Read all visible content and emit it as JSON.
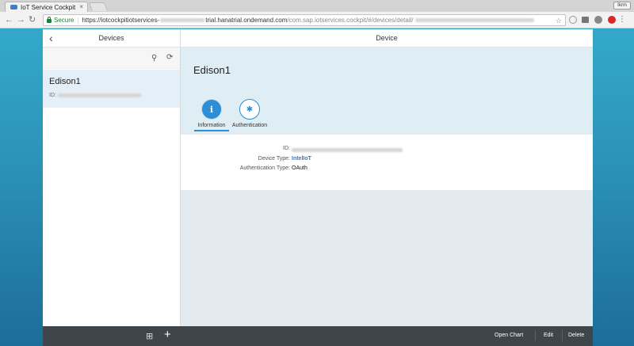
{
  "browser": {
    "tab_title": "IoT Service Cockpit",
    "tab_close": "×",
    "profile": "Ikrm",
    "secure_label": "Secure",
    "url_prefix": "https://iotcockpitiotservices-",
    "url_domain": "trial.hanatrial.ondemand.com",
    "url_path": "/com.sap.iotservices.cockpit/#/devices/detail/"
  },
  "master": {
    "title": "Devices",
    "back_icon": "chevron-left-icon",
    "search_icon": "search-icon",
    "refresh_icon": "refresh-icon",
    "items": [
      {
        "name": "Edison1",
        "id_label": "ID:"
      }
    ],
    "footer_icons": [
      "org-chart-icon",
      "add-icon"
    ]
  },
  "detail": {
    "title": "Device",
    "object_title": "Edison1",
    "tabs": [
      {
        "label": "Information",
        "icon": "info-icon",
        "selected": true
      },
      {
        "label": "Authentication",
        "icon": "badge-icon",
        "selected": false
      }
    ],
    "fields": [
      {
        "label": "ID:",
        "value": ""
      },
      {
        "label": "Device Type:",
        "value": "IntelIoT"
      },
      {
        "label": "Authentication Type:",
        "value": "OAuth"
      }
    ],
    "footer": {
      "open_chart": "Open Chart",
      "edit": "Edit",
      "delete": "Delete"
    }
  },
  "colors": {
    "accent": "#2b8ed6",
    "footer_bg": "#3e464c",
    "selected_item_bg": "#e5eff7",
    "secure_green": "#188038"
  }
}
